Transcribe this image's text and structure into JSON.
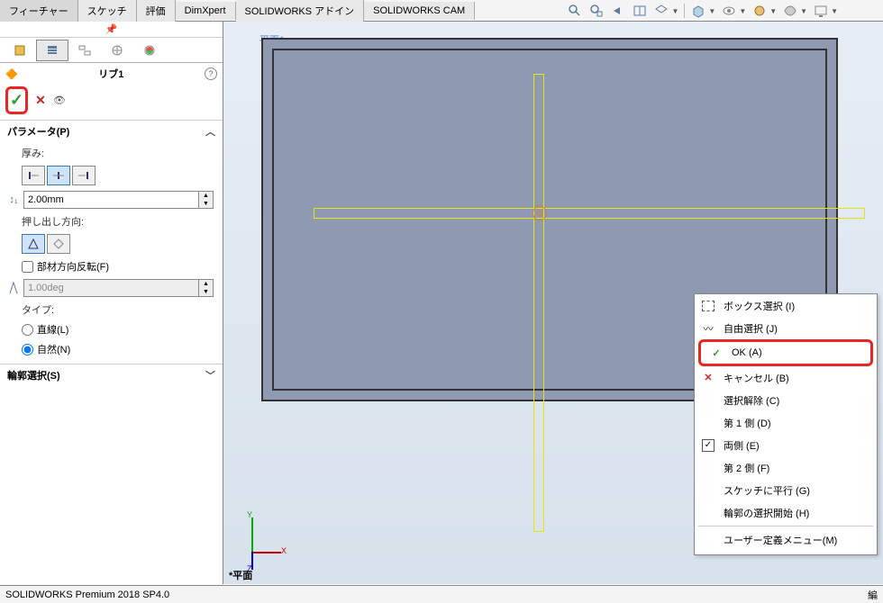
{
  "tabs": {
    "feature": "フィーチャー",
    "sketch": "スケッチ",
    "evaluate": "評価",
    "dimxpert": "DimXpert",
    "addins": "SOLIDWORKS アドイン",
    "cam": "SOLIDWORKS CAM"
  },
  "pm": {
    "title": "リブ1",
    "params_header": "パラメータ(P)",
    "thickness_label": "厚み:",
    "thickness_value": "2.00mm",
    "dir_label": "押し出し方向:",
    "flip_label": "部材方向反転(F)",
    "draft_value": "1.00deg",
    "type_label": "タイプ:",
    "radio_linear": "直線(L)",
    "radio_natural": "自然(N)",
    "contour_header": "輪郭選択(S)"
  },
  "canvas": {
    "plane_label": "平面1",
    "plane_bottom": "*平面"
  },
  "ctx": {
    "box_select": "ボックス選択 (I)",
    "free_select": "自由選択 (J)",
    "ok": "OK (A)",
    "cancel": "キャンセル (B)",
    "deselect": "選択解除 (C)",
    "side1": "第 1 側 (D)",
    "both": "両側 (E)",
    "side2": "第 2 側 (F)",
    "parallel": "スケッチに平行 (G)",
    "contour_start": "輪郭の選択開始 (H)",
    "user_menu": "ユーザー定義メニュー(M)"
  },
  "status": {
    "left": "SOLIDWORKS Premium 2018 SP4.0",
    "right": "編"
  }
}
